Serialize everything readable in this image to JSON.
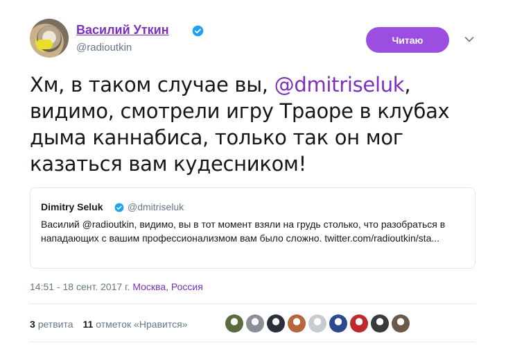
{
  "author": {
    "name": "Василий Уткин",
    "handle": "@radioutkin",
    "verified": true
  },
  "follow_button": {
    "label": "Читаю",
    "color": "#9b4ee0"
  },
  "tweet": {
    "text_before": "Хм, в таком случае вы, ",
    "mention": "@dmitriseluk",
    "text_after": ", видимо, смотрели игру Траоре в клубах дыма каннабиса, только так он мог казаться вам кудесником!"
  },
  "quoted_tweet": {
    "name": "Dimitry Seluk",
    "handle": "@dmitriseluk",
    "verified": true,
    "text": "Василий @radioutkin, видимо, вы в тот момент взяли на грудь столько, что разобраться в нападающих с вашим профессионализмом вам было сложно. twitter.com/radioutkin/sta..."
  },
  "meta": {
    "timestamp": "14:51 - 18 сент. 2017 г.",
    "location": "Москва, Россия"
  },
  "stats": {
    "retweets_count": "3",
    "retweets_label": "ретвита",
    "likes_count": "11",
    "likes_label": "отметок «Нравится»"
  },
  "liker_avatar_colors": [
    "#5a6b3e",
    "#8a8f99",
    "#2b2f3a",
    "#b7653a",
    "#c8ccd1",
    "#2e4a8f",
    "#c0282f",
    "#3a3a3a",
    "#6b5a4a"
  ],
  "colors": {
    "accent": "#7b2fbe",
    "verified": "#1da1f2",
    "muted": "#657786"
  }
}
